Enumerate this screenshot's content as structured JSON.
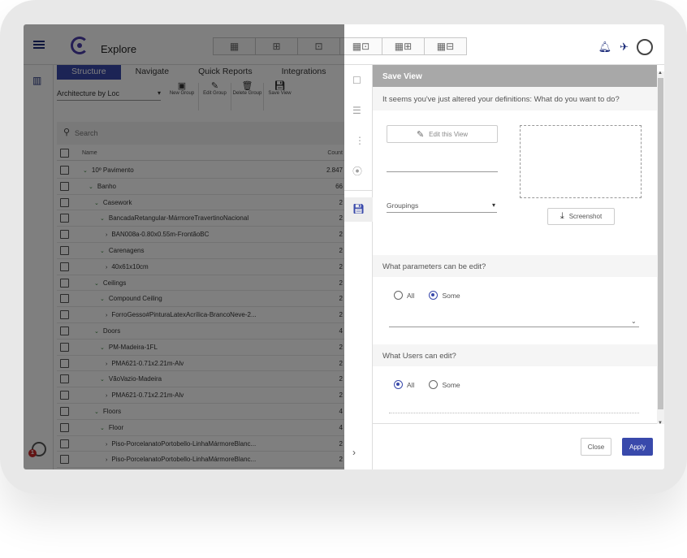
{
  "app": {
    "title": "Explore"
  },
  "toolbar": {
    "buttons": [
      "▦",
      "⊞",
      "⊡",
      "▦⊡",
      "▦⊞",
      "▦⊟"
    ]
  },
  "tabs": [
    "Structure",
    "Navigate",
    "Quick Reports",
    "Integrations"
  ],
  "location_select": "Architecture by Loc",
  "actions": [
    {
      "label": "New Group",
      "icon": "new-group-icon"
    },
    {
      "label": "Edit Group",
      "icon": "edit-icon"
    },
    {
      "label": "Delete Group",
      "icon": "trash-icon"
    },
    {
      "label": "Save View",
      "icon": "save-icon"
    }
  ],
  "search": {
    "placeholder": "Search"
  },
  "table": {
    "col_name": "Name",
    "col_count": "Count",
    "rows": [
      {
        "indent": 0,
        "arrow": "down",
        "label": "10º Pavimento",
        "count": "2.847"
      },
      {
        "indent": 1,
        "arrow": "down",
        "label": "Banho",
        "count": "66"
      },
      {
        "indent": 2,
        "arrow": "down",
        "label": "Casework",
        "count": "2"
      },
      {
        "indent": 3,
        "arrow": "down",
        "label": "BancadaRetangular-MármoreTravertinoNacional",
        "count": "2"
      },
      {
        "indent": 4,
        "arrow": "right",
        "label": "BAN008a-0.80x0.55m-FrontãoBC",
        "count": "2"
      },
      {
        "indent": 3,
        "arrow": "down",
        "label": "Carenagens",
        "count": "2"
      },
      {
        "indent": 4,
        "arrow": "right",
        "label": "40x61x10cm",
        "count": "2"
      },
      {
        "indent": 2,
        "arrow": "down",
        "label": "Ceilings",
        "count": "2"
      },
      {
        "indent": 3,
        "arrow": "down",
        "label": "Compound Ceiling",
        "count": "2"
      },
      {
        "indent": 4,
        "arrow": "right",
        "label": "ForroGesso#PinturaLatexAcrílica-BrancoNeve-2...",
        "count": "2"
      },
      {
        "indent": 2,
        "arrow": "down",
        "label": "Doors",
        "count": "4"
      },
      {
        "indent": 3,
        "arrow": "down",
        "label": "PM-Madeira-1FL",
        "count": "2"
      },
      {
        "indent": 4,
        "arrow": "right",
        "label": "PMA621-0.71x2.21m-Alv",
        "count": "2"
      },
      {
        "indent": 3,
        "arrow": "down",
        "label": "VãoVazio-Madeira",
        "count": "2"
      },
      {
        "indent": 4,
        "arrow": "right",
        "label": "PMA621-0.71x2.21m-Alv",
        "count": "2"
      },
      {
        "indent": 2,
        "arrow": "down",
        "label": "Floors",
        "count": "4"
      },
      {
        "indent": 3,
        "arrow": "down",
        "label": "Floor",
        "count": "4"
      },
      {
        "indent": 4,
        "arrow": "right",
        "label": "Piso-PorcelanatoPortobello-LinhaMármoreBlanc...",
        "count": "2"
      },
      {
        "indent": 4,
        "arrow": "right",
        "label": "Piso-PorcelanatoPortobello-LinhaMármoreBlanc...",
        "count": "2"
      }
    ]
  },
  "modal": {
    "title": "Save View",
    "question": "It seems you've just altered your definitions: What do you want to do?",
    "edit_view_label": "Edit this View",
    "groupings_label": "Groupings",
    "screenshot_label": "Screenshot",
    "params_section": "What parameters can be edit?",
    "params_options": [
      "All",
      "Some"
    ],
    "params_selected": "Some",
    "users_section": "What Users can edit?",
    "users_options": [
      "All",
      "Some"
    ],
    "users_selected": "All",
    "close_label": "Close",
    "apply_label": "Apply"
  },
  "notification_count": "1",
  "colors": {
    "accent": "#3949ab",
    "header_gray": "#a8a8a8",
    "tree_arrow": "#2e7d32"
  }
}
